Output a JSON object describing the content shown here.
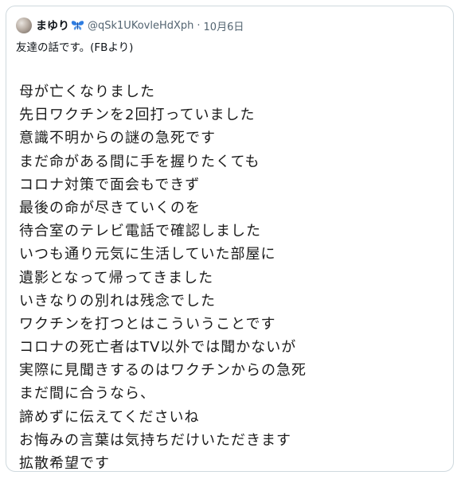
{
  "tweet": {
    "author": {
      "display_name": "まゆり",
      "badge_icon": "butterfly-icon",
      "handle": "@qSk1UKovleHdXph",
      "separator": "·",
      "date": "10月6日"
    },
    "intro": "友達の話です。(FBより)",
    "lines": [
      "母が亡くなりました",
      "先日ワクチンを2回打っていました",
      "意識不明からの謎の急死です",
      "まだ命がある間に手を握りたくても",
      "コロナ対策で面会もできず",
      "最後の命が尽きていくのを",
      "待合室のテレビ電話で確認しました",
      "いつも通り元気に生活していた部屋に",
      "遺影となって帰ってきました",
      "いきなりの別れは残念でした",
      "ワクチンを打つとはこういうことです",
      "コロナの死亡者はTV以外では聞かないが",
      "実際に見聞きするのはワクチンからの急死",
      "まだ間に合うなら、",
      "諦めずに伝えてくださいね",
      "お悔みの言葉は気持ちだけいただきます",
      "拡散希望です"
    ]
  },
  "colors": {
    "border": "#cfd9de",
    "muted": "#536471",
    "text": "#0f1419",
    "badge": "#2f7de1"
  }
}
